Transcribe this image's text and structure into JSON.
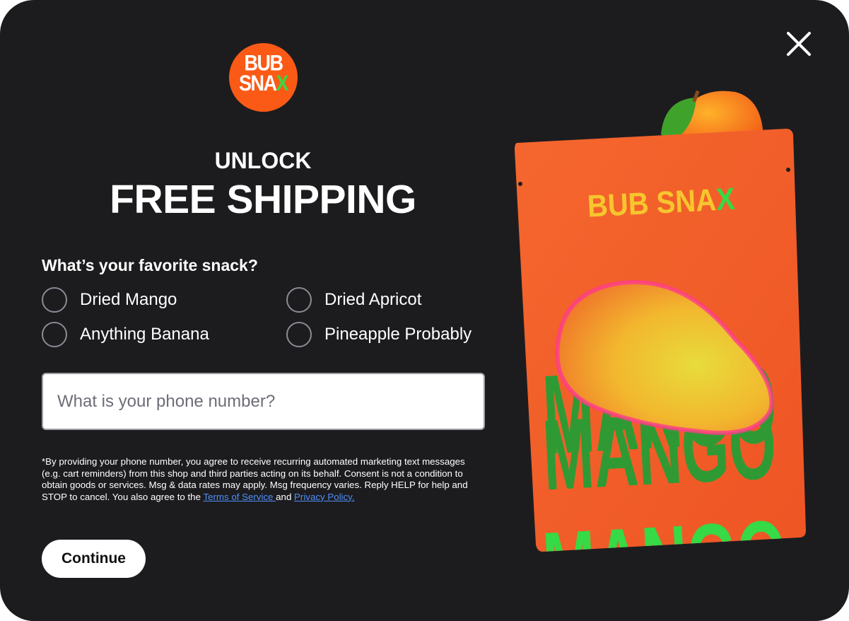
{
  "logo": {
    "line1": "BUB",
    "line2_main": "SNA",
    "line2_accent": "X"
  },
  "close_label": "Close",
  "headline": {
    "line1": "UNLOCK",
    "line2": "FREE SHIPPING"
  },
  "question": "What’s your favorite snack?",
  "options": [
    {
      "label": "Dried Mango",
      "selected": false
    },
    {
      "label": "Dried Apricot",
      "selected": false
    },
    {
      "label": "Anything Banana",
      "selected": false
    },
    {
      "label": "Pineapple Probably",
      "selected": false
    }
  ],
  "phone": {
    "placeholder": "What is your phone number?",
    "value": ""
  },
  "legal": {
    "text": "*By providing your phone number, you agree to receive recurring automated marketing text messages (e.g. cart reminders) from this shop and third parties acting on its behalf. Consent is not a condition to obtain goods or services. Msg & data rates may apply. Msg frequency varies. Reply HELP for help and STOP to cancel.  You also agree to the ",
    "terms_link": "Terms of Service ",
    "and": "and ",
    "privacy_link": "Privacy Policy."
  },
  "continue_label": "Continue",
  "product": {
    "brand_main": "BUB SNA",
    "brand_accent": "X",
    "flavor_word": "MANGO"
  },
  "colors": {
    "background": "#1c1c1f",
    "brand_orange": "#fa5a16",
    "accent_green": "#36d946",
    "link_blue": "#4f8ff7",
    "pouch_orange": "#f2602c",
    "brand_yellow": "#f7c62e"
  },
  "icons": {
    "close": "close-icon"
  }
}
